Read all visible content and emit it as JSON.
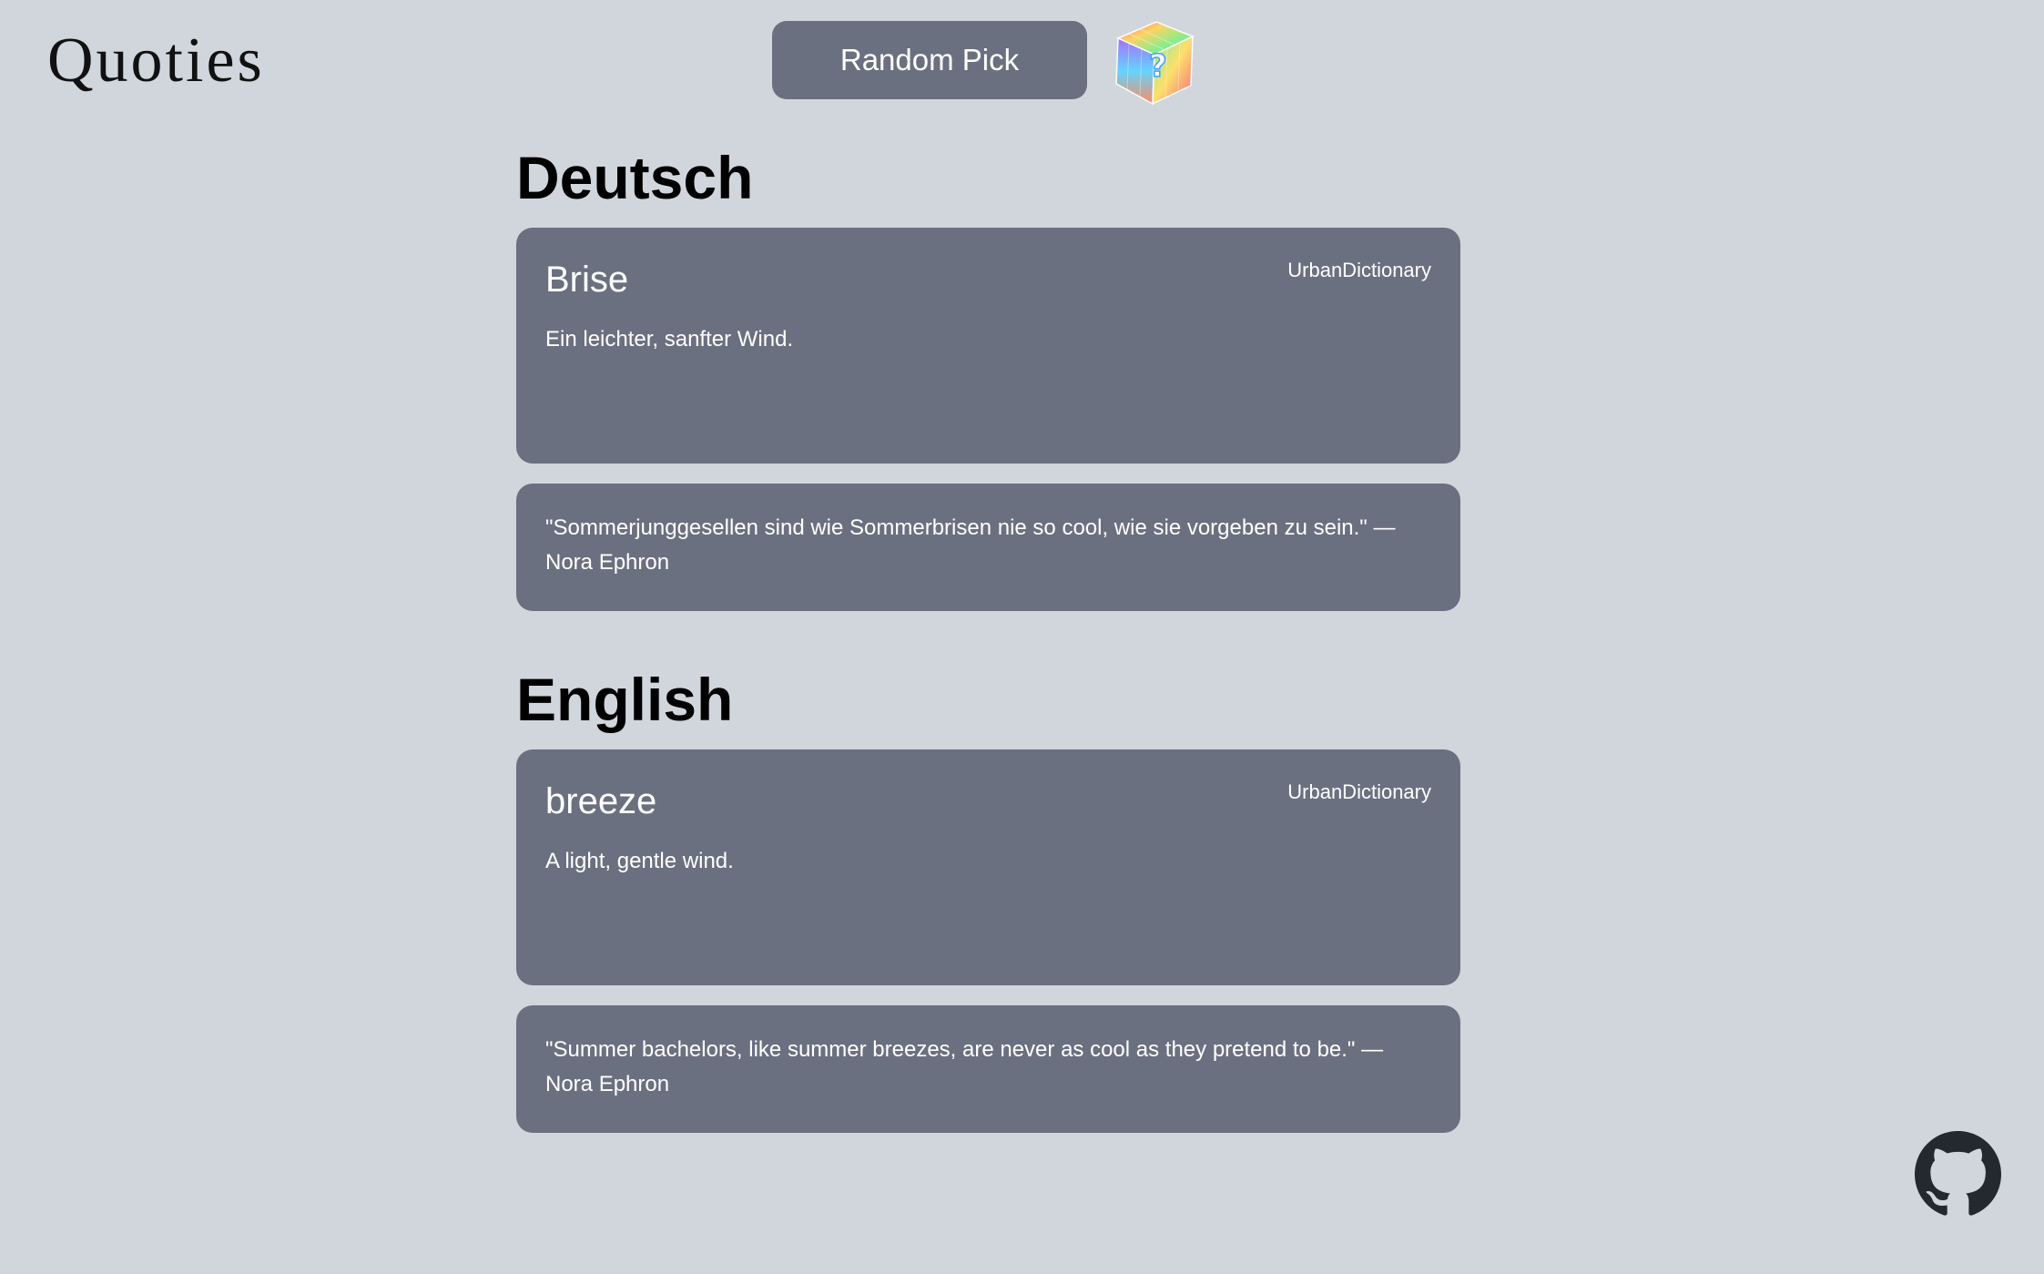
{
  "header": {
    "logo_text": "Quoties",
    "random_button_label": "Random Pick",
    "dice_icon": "rainbow-question-cube-icon"
  },
  "sections": [
    {
      "heading": "Deutsch",
      "word": {
        "title": "Brise",
        "source": "UrbanDictionary",
        "definition": "Ein leichter, sanfter Wind."
      },
      "quote": "\"Sommerjunggesellen sind wie Sommerbrisen nie so cool, wie sie vorgeben zu sein.\" — Nora Ephron"
    },
    {
      "heading": "English",
      "word": {
        "title": "breeze",
        "source": "UrbanDictionary",
        "definition": "A light, gentle wind."
      },
      "quote": "\"Summer bachelors, like summer breezes, are never as cool as they pretend to be.\" — Nora Ephron"
    }
  ],
  "footer": {
    "github_icon": "github-icon"
  },
  "colors": {
    "background": "#d1d5dc",
    "card": "#6b7080",
    "card_text": "#ffffff",
    "heading_text": "#000000"
  }
}
